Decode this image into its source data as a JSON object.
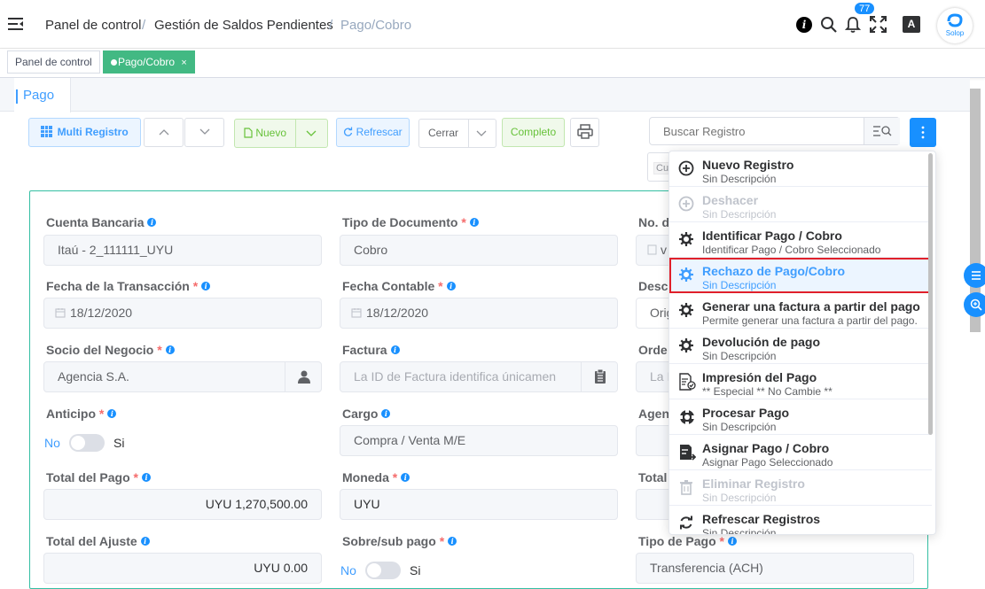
{
  "header": {
    "breadcrumb": [
      "Panel de control",
      "/",
      "Gestión de Saldos Pendientes",
      "/",
      "Pago/Cobro"
    ],
    "notification_count": "77",
    "avatar_label": "Solop"
  },
  "tags": {
    "panel": "Panel de control",
    "pago": "Pago/Cobro",
    "close": "×"
  },
  "tab": {
    "label": "Pago"
  },
  "toolbar": {
    "multi": "Multi Registro",
    "nuevo": "Nuevo",
    "refrescar": "Refrescar",
    "cerrar": "Cerrar",
    "completo": "Completo",
    "search_placeholder": "Buscar Registro",
    "filter_chip": "Cu"
  },
  "form": {
    "cuenta_label": "Cuenta Bancaria",
    "cuenta_value": "Itaú - 2_111111_UYU",
    "tipo_doc_label": "Tipo de Documento",
    "tipo_doc_value": "Cobro",
    "nodoc_label": "No. d",
    "nodoc_value": "v",
    "fecha_tr_label": "Fecha de la Transacción",
    "fecha_tr_value": "18/12/2020",
    "fecha_cont_label": "Fecha Contable",
    "fecha_cont_value": "18/12/2020",
    "desc_label": "Desc",
    "desc_value": "Orig",
    "socio_label": "Socio del Negocio",
    "socio_value": "Agencia S.A.",
    "factura_label": "Factura",
    "factura_placeholder": "La ID de Factura identifica únicamen",
    "orden_label": "Orde",
    "orden_value": "La I",
    "anticipo_label": "Anticipo",
    "no": "No",
    "si": "Si",
    "cargo_label": "Cargo",
    "cargo_value": "Compra / Venta M/E",
    "agen_label": "Agen",
    "total_pago_label": "Total del Pago",
    "total_pago_value": "UYU 1,270,500.00",
    "moneda_label": "Moneda",
    "moneda_value": "UYU",
    "total_label": "Total",
    "total_ajuste_label": "Total del Ajuste",
    "total_ajuste_value": "UYU 0.00",
    "sobre_label": "Sobre/sub pago",
    "tipo_pago_label": "Tipo de Pago",
    "tipo_pago_value": "Transferencia (ACH)"
  },
  "menu": [
    {
      "title": "Nuevo Registro",
      "desc": "Sin Descripción",
      "icon": "plus-circle-icon",
      "disabled": false
    },
    {
      "title": "Deshacer",
      "desc": "Sin Descripción",
      "icon": "plus-circle-icon",
      "disabled": true
    },
    {
      "title": "Identificar Pago / Cobro",
      "desc": "Identificar Pago / Cobro Seleccionado",
      "icon": "gear-icon",
      "disabled": false
    },
    {
      "title": "Rechazo de Pago/Cobro",
      "desc": "Sin Descripción",
      "icon": "gear-icon",
      "disabled": false
    },
    {
      "title": "Generar una factura a partir del pago",
      "desc": "Permite generar una factura a partir del pago.",
      "icon": "gear-icon",
      "disabled": false
    },
    {
      "title": "Devolución de pago",
      "desc": "Sin Descripción",
      "icon": "gear-icon",
      "disabled": false
    },
    {
      "title": "Impresión del Pago",
      "desc": "** Especial ** No Cambie **",
      "icon": "report-icon",
      "disabled": false
    },
    {
      "title": "Procesar Pago",
      "desc": "Sin Descripción",
      "icon": "workflow-icon",
      "disabled": false
    },
    {
      "title": "Asignar Pago / Cobro",
      "desc": "Asignar Pago Seleccionado",
      "icon": "assign-icon",
      "disabled": false
    },
    {
      "title": "Eliminar Registro",
      "desc": "Sin Descripción",
      "icon": "trash-icon",
      "disabled": true
    },
    {
      "title": "Refrescar Registros",
      "desc": "Sin Descripción",
      "icon": "refresh-icon",
      "disabled": false
    }
  ],
  "colors": {
    "accent": "#409eff",
    "success": "#67c23a",
    "tag_active": "#42b983",
    "highlight_border": "#e0202a"
  }
}
